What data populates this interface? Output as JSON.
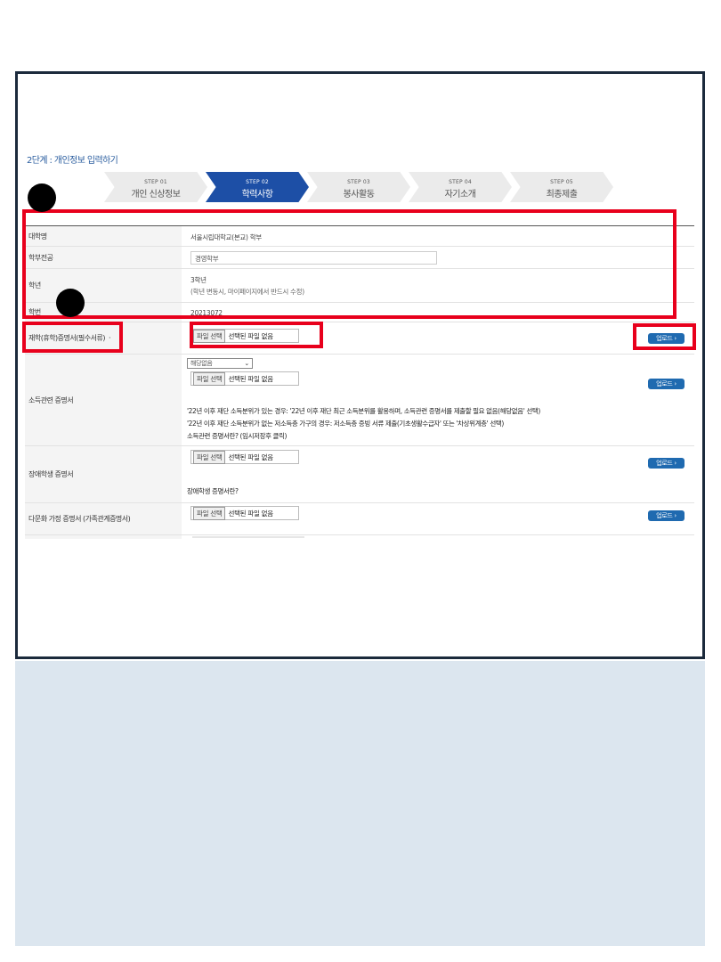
{
  "page": {
    "step_title": "2단계 : 개인정보 입력하기"
  },
  "steps": [
    {
      "num": "STEP 01",
      "label": "개인 신상정보"
    },
    {
      "num": "STEP 02",
      "label": "학력사항"
    },
    {
      "num": "STEP 03",
      "label": "봉사활동"
    },
    {
      "num": "STEP 04",
      "label": "자기소개"
    },
    {
      "num": "STEP 05",
      "label": "최종제출"
    }
  ],
  "form": {
    "university": {
      "label": "대학명",
      "value": "서울시립대학교(본교) 학부"
    },
    "major": {
      "label": "학부전공",
      "value": "경영학부"
    },
    "grade": {
      "label": "학년",
      "value": "3학년",
      "note": "(학년 변동시, 마이페이지에서 반드시 수정)"
    },
    "student_id": {
      "label": "학번",
      "value": "20213072"
    },
    "enrollment_cert": {
      "label": "재학(휴학)증명서(필수서류)",
      "required_mark": "·"
    },
    "income_cert": {
      "label": "소득관련 증명서",
      "select_value": "해당없음",
      "notes": [
        "'22년 이후 재단 소득분위가 있는 경우: '22년 이후 재단 최근 소득분위를 활용하며, 소득관련 증명서를 제출할 필요 없음(해당없음' 선택)",
        "'22년 이후 재단 소득분위가 없는 저소득층 가구의 경우: 저소득층 증빙 서류 제출(기초생활수급자' 또는 '차상위계층' 선택)",
        "소득관련 증명서란? (임시저장후 클릭)"
      ]
    },
    "disability_cert": {
      "label": "장애학생 증명서",
      "note": "장애학생 증명서란?"
    },
    "multicultural_cert": {
      "label": "다문화 가정 증명서 (가족관계증명서)"
    }
  },
  "file_input": {
    "button_label": "파일 선택",
    "status": "선택된 파일 없음"
  },
  "upload_label": "업로드 ›",
  "colors": {
    "accent": "#1d4fa6",
    "highlight": "#e8001c",
    "upload": "#1f6ab0",
    "frame": "#1b2a3c",
    "backdrop": "#dce6ef"
  }
}
